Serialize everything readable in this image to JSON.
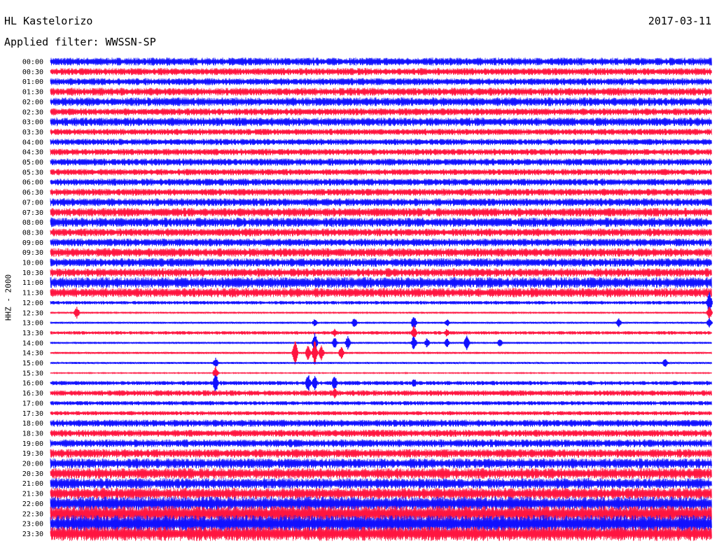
{
  "header": {
    "station": "HL Kastelorizo",
    "date": "2017-03-11",
    "filter_text": "Applied filter: WWSSN-SP"
  },
  "chart_data": {
    "type": "line",
    "title": "HL Kastelorizo",
    "ylabel": "HHZ - 2000",
    "series_colors": [
      "#1010ff",
      "#ff1540"
    ],
    "x_range_minutes": [
      0,
      30
    ],
    "rows": [
      {
        "time": "00:00",
        "level": 0.55,
        "events": []
      },
      {
        "time": "00:30",
        "level": 0.5,
        "events": []
      },
      {
        "time": "01:00",
        "level": 0.5,
        "events": []
      },
      {
        "time": "01:30",
        "level": 0.55,
        "events": []
      },
      {
        "time": "02:00",
        "level": 0.6,
        "events": []
      },
      {
        "time": "02:30",
        "level": 0.5,
        "events": []
      },
      {
        "time": "03:00",
        "level": 0.6,
        "events": []
      },
      {
        "time": "03:30",
        "level": 0.45,
        "events": []
      },
      {
        "time": "04:00",
        "level": 0.45,
        "events": []
      },
      {
        "time": "04:30",
        "level": 0.45,
        "events": []
      },
      {
        "time": "05:00",
        "level": 0.5,
        "events": []
      },
      {
        "time": "05:30",
        "level": 0.45,
        "events": []
      },
      {
        "time": "06:00",
        "level": 0.5,
        "events": []
      },
      {
        "time": "06:30",
        "level": 0.5,
        "events": []
      },
      {
        "time": "07:00",
        "level": 0.55,
        "events": []
      },
      {
        "time": "07:30",
        "level": 0.6,
        "events": []
      },
      {
        "time": "08:00",
        "level": 0.65,
        "events": []
      },
      {
        "time": "08:30",
        "level": 0.55,
        "events": []
      },
      {
        "time": "09:00",
        "level": 0.55,
        "events": []
      },
      {
        "time": "09:30",
        "level": 0.6,
        "events": []
      },
      {
        "time": "10:00",
        "level": 0.6,
        "events": []
      },
      {
        "time": "10:30",
        "level": 0.6,
        "events": []
      },
      {
        "time": "11:00",
        "level": 0.75,
        "events": []
      },
      {
        "time": "11:30",
        "level": 0.65,
        "events": []
      },
      {
        "time": "12:00",
        "level": 0.25,
        "events": [
          {
            "t": 0.997,
            "a": 18
          }
        ]
      },
      {
        "time": "12:30",
        "level": 0.12,
        "events": [
          {
            "t": 0.04,
            "a": 10
          },
          {
            "t": 0.997,
            "a": 10
          }
        ]
      },
      {
        "time": "13:00",
        "level": 0.15,
        "events": [
          {
            "t": 0.4,
            "a": 6
          },
          {
            "t": 0.46,
            "a": 8
          },
          {
            "t": 0.55,
            "a": 12
          },
          {
            "t": 0.6,
            "a": 6
          },
          {
            "t": 0.86,
            "a": 7
          },
          {
            "t": 0.997,
            "a": 8
          }
        ]
      },
      {
        "time": "13:30",
        "level": 0.25,
        "events": [
          {
            "t": 0.43,
            "a": 6
          },
          {
            "t": 0.55,
            "a": 12
          },
          {
            "t": 0.6,
            "a": 7
          }
        ]
      },
      {
        "time": "14:00",
        "level": 0.15,
        "events": [
          {
            "t": 0.4,
            "a": 16
          },
          {
            "t": 0.43,
            "a": 9
          },
          {
            "t": 0.45,
            "a": 11
          },
          {
            "t": 0.55,
            "a": 12
          },
          {
            "t": 0.57,
            "a": 8
          },
          {
            "t": 0.6,
            "a": 7
          },
          {
            "t": 0.63,
            "a": 13
          },
          {
            "t": 0.68,
            "a": 7
          }
        ]
      },
      {
        "time": "14:30",
        "level": 0.15,
        "events": [
          {
            "t": 0.37,
            "a": 20
          },
          {
            "t": 0.39,
            "a": 14
          },
          {
            "t": 0.4,
            "a": 20
          },
          {
            "t": 0.41,
            "a": 12
          },
          {
            "t": 0.44,
            "a": 10
          }
        ]
      },
      {
        "time": "15:00",
        "level": 0.15,
        "events": [
          {
            "t": 0.25,
            "a": 8
          },
          {
            "t": 0.93,
            "a": 7
          }
        ]
      },
      {
        "time": "15:30",
        "level": 0.08,
        "events": [
          {
            "t": 0.25,
            "a": 10
          }
        ]
      },
      {
        "time": "16:00",
        "level": 0.3,
        "events": [
          {
            "t": 0.25,
            "a": 16
          },
          {
            "t": 0.39,
            "a": 14
          },
          {
            "t": 0.4,
            "a": 12
          },
          {
            "t": 0.43,
            "a": 14
          },
          {
            "t": 0.55,
            "a": 8
          }
        ]
      },
      {
        "time": "16:30",
        "level": 0.4,
        "events": [
          {
            "t": 0.43,
            "a": 8
          }
        ]
      },
      {
        "time": "17:00",
        "level": 0.3,
        "events": []
      },
      {
        "time": "17:30",
        "level": 0.3,
        "events": []
      },
      {
        "time": "18:00",
        "level": 0.5,
        "events": []
      },
      {
        "time": "18:30",
        "level": 0.5,
        "events": []
      },
      {
        "time": "19:00",
        "level": 0.55,
        "events": []
      },
      {
        "time": "19:30",
        "level": 0.6,
        "events": []
      },
      {
        "time": "20:00",
        "level": 0.7,
        "events": []
      },
      {
        "time": "20:30",
        "level": 0.75,
        "events": []
      },
      {
        "time": "21:00",
        "level": 0.75,
        "events": []
      },
      {
        "time": "21:30",
        "level": 0.8,
        "events": []
      },
      {
        "time": "22:00",
        "level": 1.0,
        "events": []
      },
      {
        "time": "22:30",
        "level": 1.1,
        "events": []
      },
      {
        "time": "23:00",
        "level": 1.2,
        "events": []
      },
      {
        "time": "23:30",
        "level": 1.0,
        "events": []
      }
    ]
  }
}
